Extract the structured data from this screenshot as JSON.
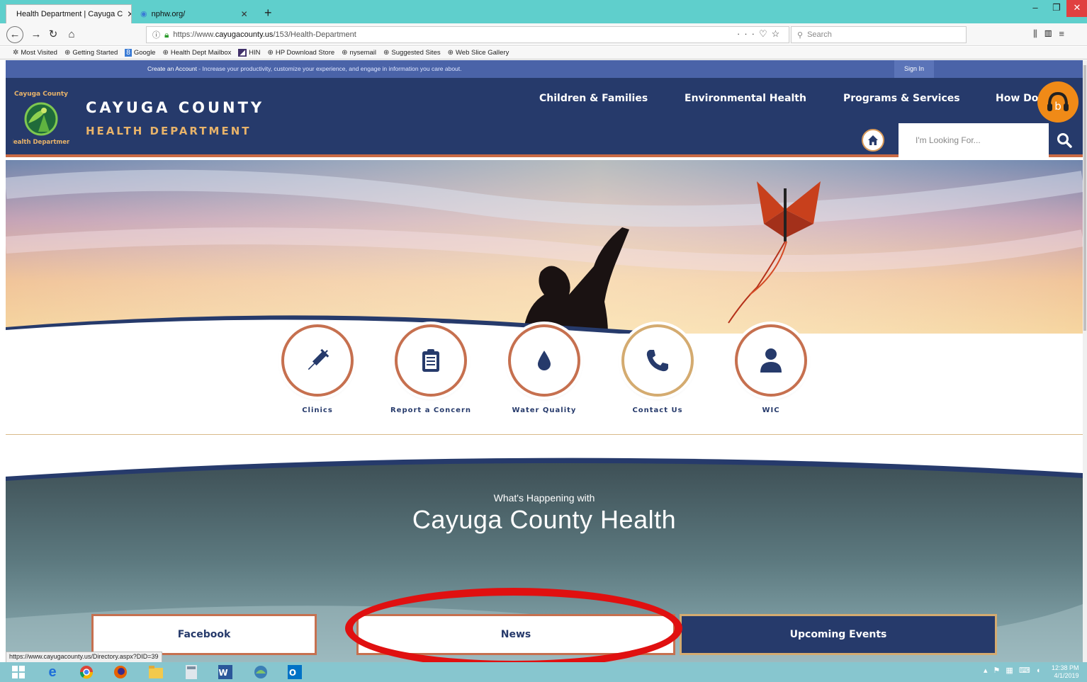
{
  "browser": {
    "tabs": [
      {
        "title": "Health Department | Cayuga C",
        "active": true
      },
      {
        "title": "nphw.org/",
        "active": false
      }
    ],
    "url_prefix": "https://www.",
    "url_domain": "cayugacounty.us",
    "url_path": "/153/Health-Department",
    "search_placeholder": "Search",
    "bookmarks": [
      "Most Visited",
      "Getting Started",
      "Google",
      "Health Dept Mailbox",
      "HIN",
      "HP Download Store",
      "nysemail",
      "Suggested Sites",
      "Web Slice Gallery"
    ],
    "status_url": "https://www.cayugacounty.us/Directory.aspx?DID=39"
  },
  "site": {
    "notice_link": "Create an Account",
    "notice_text": " - Increase your productivity, customize your experience, and engage in information you care about.",
    "sign_in": "Sign In",
    "logo_top": "Cayuga County",
    "logo_bottom": "Health Department",
    "org_name": "CAYUGA COUNTY",
    "org_dept": "HEALTH DEPARTMENT",
    "nav": [
      "Children & Families",
      "Environmental Health",
      "Programs & Services",
      "How Do I"
    ],
    "search_placeholder": "I'm Looking For..."
  },
  "quick_links": [
    {
      "label": "Clinics",
      "icon": "syringe-icon"
    },
    {
      "label": "Report a Concern",
      "icon": "clipboard-icon"
    },
    {
      "label": "Water Quality",
      "icon": "water-drop-icon"
    },
    {
      "label": "Contact Us",
      "icon": "phone-icon"
    },
    {
      "label": "WIC",
      "icon": "person-icon"
    }
  ],
  "happening": {
    "subtitle": "What's Happening with",
    "title": "Cayuga County Health",
    "buttons": [
      "Facebook",
      "News",
      "Upcoming Events"
    ]
  },
  "taskbar": {
    "time": "12:38 PM",
    "date": "4/1/2019"
  },
  "colors": {
    "navy": "#263a6b",
    "accent": "#c96a45",
    "gold": "#d4ab70",
    "annotation": "#e01010"
  }
}
